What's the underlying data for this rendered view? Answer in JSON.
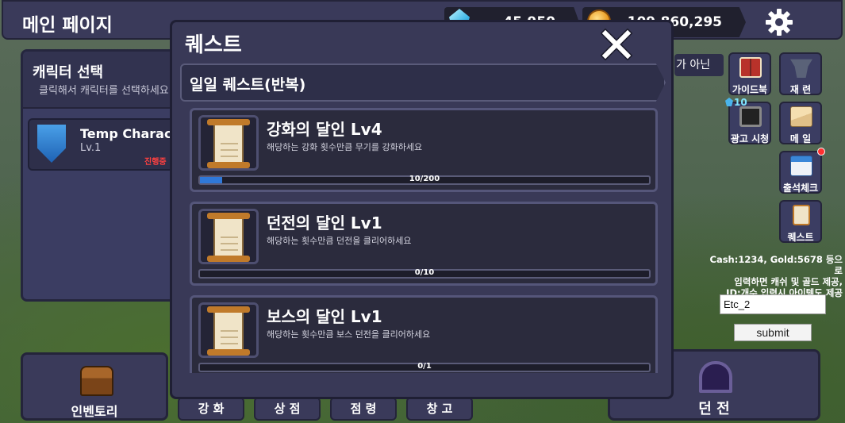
{
  "top_bar": {
    "page_title": "메인 페이지",
    "gem_amount": "45,950",
    "gold_amount": "109,860,295"
  },
  "character_panel": {
    "title": "캐릭터 선택",
    "subtitle": "클릭해서 캐릭터를 선택하세요",
    "character": {
      "name": "Temp Character",
      "level": "Lv.1",
      "status": "진행중"
    }
  },
  "bottom_nav": {
    "inventory": "인벤토리",
    "tabs": [
      "강 화",
      "상 점",
      "점 령",
      "창 고"
    ],
    "dungeon": "던 전"
  },
  "side_menu": {
    "peek_text": "가 아닌",
    "items": [
      {
        "label": "가이드북",
        "icon": "book-icon"
      },
      {
        "label": "재 련",
        "icon": "anvil-icon"
      },
      {
        "label": "광고 시청",
        "icon": "tv-icon",
        "count": "10"
      },
      {
        "label": "메 일",
        "icon": "mail-icon"
      },
      {
        "label": "출석체크",
        "icon": "calendar-icon",
        "badge": true
      },
      {
        "label": "퀘스트",
        "icon": "scroll-icon"
      }
    ]
  },
  "redeem": {
    "hint_lines": [
      "Cash:1234, Gold:5678 등으로",
      "입력하면 캐쉬 및 골드 제공,",
      "ID:개수 입력시 아이템도 제공"
    ],
    "input_value": "Etc_2",
    "submit_label": "submit"
  },
  "quest_modal": {
    "title": "퀘스트",
    "category": "일일 퀘스트(반복)",
    "quests": [
      {
        "title": "강화의 달인 Lv4",
        "description": "해당하는 강화 횟수만큼 무기를 강화하세요",
        "progress_text": "10/200",
        "progress": 0.05
      },
      {
        "title": "던전의 달인 Lv1",
        "description": "해당하는 횟수만큼 던전을 클리어하세요",
        "progress_text": "0/10",
        "progress": 0
      },
      {
        "title": "보스의 달인 Lv1",
        "description": "해당하는 횟수만큼 보스 던전을 클리어하세요",
        "progress_text": "0/1",
        "progress": 0
      }
    ]
  },
  "colors": {
    "panel": "#393957",
    "progress_fill": "#2f78d8",
    "status_red": "#ff4040"
  }
}
